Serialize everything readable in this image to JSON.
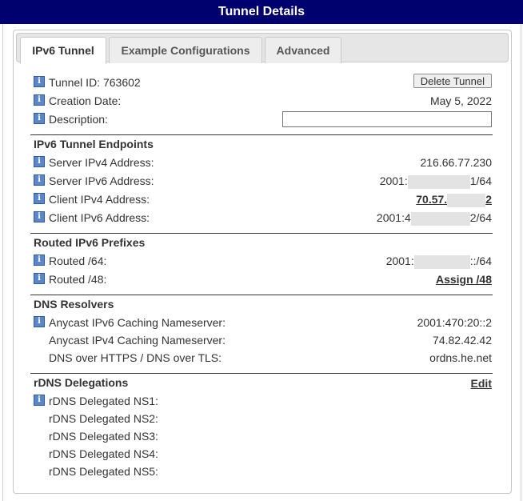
{
  "title": "Tunnel Details",
  "tabs": [
    "IPv6 Tunnel",
    "Example Configurations",
    "Advanced"
  ],
  "tunnel": {
    "id_label": "Tunnel ID: 763602",
    "delete_label": "Delete Tunnel",
    "created_label": "Creation Date:",
    "created_value": "May 5, 2022",
    "desc_label": "Description:",
    "desc_value": ""
  },
  "endpoints": {
    "heading": "IPv6 Tunnel Endpoints",
    "server_v4_label": "Server IPv4 Address:",
    "server_v4_value": "216.66.77.230",
    "server_v6_label": "Server IPv6 Address:",
    "server_v6_pre": "2001:",
    "server_v6_post": "1/64",
    "client_v4_label": "Client IPv4 Address:",
    "client_v4_pre": "70.57.",
    "client_v4_post": "2",
    "client_v6_label": "Client IPv6 Address:",
    "client_v6_pre": "2001:4",
    "client_v6_post": "2/64"
  },
  "prefixes": {
    "heading": "Routed IPv6 Prefixes",
    "r64_label": "Routed /64:",
    "r64_pre": "2001:",
    "r64_post": "::/64",
    "r48_label": "Routed /48:",
    "r48_action": "Assign /48"
  },
  "dns": {
    "heading": "DNS Resolvers",
    "v6_label": "Anycast IPv6 Caching Nameserver:",
    "v6_value": "2001:470:20::2",
    "v4_label": "Anycast IPv4 Caching Nameserver:",
    "v4_value": "74.82.42.42",
    "doh_label": "DNS over HTTPS / DNS over TLS:",
    "doh_value": "ordns.he.net"
  },
  "rdns": {
    "heading": "rDNS Delegations",
    "edit": "Edit",
    "ns1": "rDNS Delegated NS1:",
    "ns2": "rDNS Delegated NS2:",
    "ns3": "rDNS Delegated NS3:",
    "ns4": "rDNS Delegated NS4:",
    "ns5": "rDNS Delegated NS5:"
  },
  "icons": {
    "info": "info-icon"
  },
  "colors": {
    "titlebar": "#00006e",
    "info_icon": "#5b86c7",
    "redaction": "#e3e3e3"
  }
}
